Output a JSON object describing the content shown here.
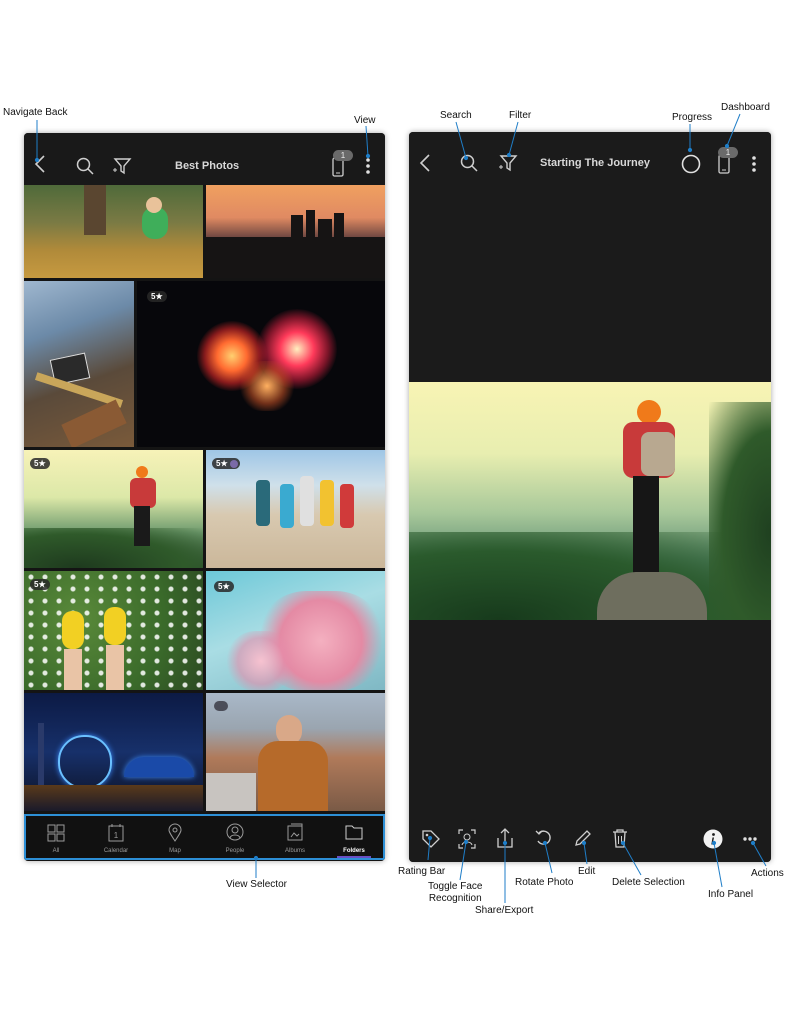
{
  "callouts": {
    "navigate_back": "Navigate Back",
    "view": "View",
    "view_selector": "View Selector",
    "search": "Search",
    "filter": "Filter",
    "progress": "Progress",
    "dashboard": "Dashboard",
    "rating_bar": "Rating Bar",
    "toggle_face_recognition_line1": "Toggle Face",
    "toggle_face_recognition_line2": "Recognition",
    "share_export": "Share/Export",
    "rotate_photo": "Rotate Photo",
    "edit": "Edit",
    "delete_selection": "Delete Selection",
    "info_panel": "Info Panel",
    "actions": "Actions"
  },
  "left_screen": {
    "title": "Best Photos",
    "device_badge": "1",
    "photos": [
      {
        "name": "girl-in-leaves",
        "rating": ""
      },
      {
        "name": "city-skyline-sunset",
        "rating": ""
      },
      {
        "name": "back-to-school-desk",
        "rating": ""
      },
      {
        "name": "fireworks",
        "rating": "5★"
      },
      {
        "name": "hiker-on-cliff",
        "rating": "5★"
      },
      {
        "name": "friends-on-beach",
        "rating": "5★"
      },
      {
        "name": "yellow-shoes-daisies",
        "rating": "5★"
      },
      {
        "name": "cherry-blossoms",
        "rating": "5★"
      },
      {
        "name": "ferris-wheel-night",
        "rating": ""
      },
      {
        "name": "selfie-canyon",
        "rating": ""
      }
    ],
    "view_selector": [
      {
        "label": "All",
        "icon": "grid-icon"
      },
      {
        "label": "Calendar",
        "icon": "calendar-icon"
      },
      {
        "label": "Map",
        "icon": "map-pin-icon"
      },
      {
        "label": "People",
        "icon": "person-icon"
      },
      {
        "label": "Albums",
        "icon": "album-icon"
      },
      {
        "label": "Folders",
        "icon": "folder-icon"
      }
    ],
    "active_view": "Folders"
  },
  "right_screen": {
    "title": "Starting The Journey",
    "device_badge": "1"
  },
  "colors": {
    "accent": "#2d8fd6",
    "active_underline": "#6a4fc4",
    "background": "#141414"
  }
}
